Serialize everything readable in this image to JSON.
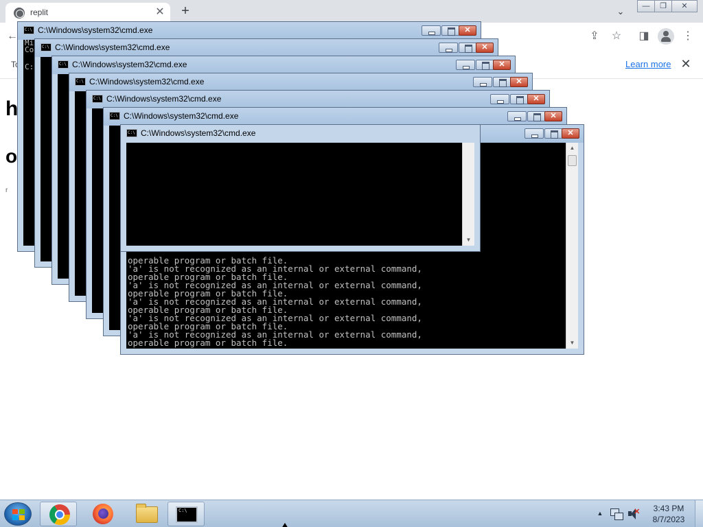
{
  "browser": {
    "tab_title": "replit",
    "tab_close": "✕",
    "new_tab": "+",
    "tabstrip_chevron": "⌄",
    "window_controls": {
      "minimize": "—",
      "restore": "❐",
      "close": "✕"
    },
    "toolbar": {
      "back": "←",
      "share": "⇪",
      "star": "☆",
      "sidepanel": "◨",
      "menu": "⋮"
    },
    "infobar": {
      "text": "To",
      "learn_more": "Learn more",
      "close": "✕"
    },
    "page": {
      "heading1": "h",
      "heading2": "o",
      "small": "r"
    }
  },
  "cmd": {
    "title": "C:\\Windows\\system32\\cmd.exe",
    "icon_text": "C:\\",
    "first_window_lines": [
      "Mi",
      "Co",
      "",
      "C: Us"
    ],
    "console_lines": [
      "operable program or batch file.",
      "'a' is not recognized as an internal or external command,"
    ],
    "scroll_up": "▲",
    "scroll_down": "▼"
  },
  "taskbar": {
    "apps": [
      {
        "name": "chrome",
        "active": true
      },
      {
        "name": "firefox",
        "active": false
      },
      {
        "name": "file-explorer",
        "active": false
      },
      {
        "name": "command-prompt",
        "active": true
      }
    ],
    "tray_arrow": "▲",
    "mute_mark": "✕",
    "time": "3:43 PM",
    "date": "8/7/2023"
  }
}
